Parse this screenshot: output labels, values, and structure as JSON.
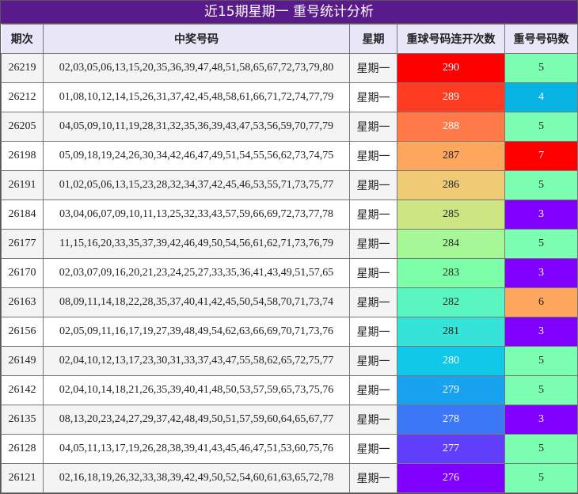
{
  "title": "近15期星期一 重号统计分析",
  "headers": [
    "期次",
    "中奖号码",
    "星期",
    "重球号码连开次数",
    "重号号码数"
  ],
  "rows": [
    {
      "period": "26219",
      "numbers": "02,03,05,06,13,15,20,35,36,39,47,48,51,58,65,67,72,73,79,80",
      "weekday": "星期一",
      "consecutive": "290",
      "repeat": "5",
      "consec_bg": "#ff0000",
      "repeat_bg": "#7dffb3"
    },
    {
      "period": "26212",
      "numbers": "01,08,10,12,14,15,26,31,37,42,45,48,58,61,66,71,72,74,77,79",
      "weekday": "星期一",
      "consecutive": "289",
      "repeat": "4",
      "consec_bg": "#ff3b22",
      "repeat_bg": "#06b3e3"
    },
    {
      "period": "26205",
      "numbers": "04,05,09,10,11,19,28,31,32,35,36,39,43,47,53,56,59,70,77,79",
      "weekday": "星期一",
      "consecutive": "288",
      "repeat": "5",
      "consec_bg": "#ff7a48",
      "repeat_bg": "#7dffb3"
    },
    {
      "period": "26198",
      "numbers": "05,09,18,19,24,26,30,34,42,46,47,49,51,54,55,56,62,73,74,75",
      "weekday": "星期一",
      "consecutive": "287",
      "repeat": "7",
      "consec_bg": "#fda65e",
      "repeat_bg": "#ff0000"
    },
    {
      "period": "26191",
      "numbers": "01,02,05,06,13,15,23,28,32,34,37,42,45,46,53,55,71,73,75,77",
      "weekday": "星期一",
      "consecutive": "286",
      "repeat": "5",
      "consec_bg": "#eecb74",
      "repeat_bg": "#7dffb3"
    },
    {
      "period": "26184",
      "numbers": "03,04,06,07,09,10,11,13,25,32,33,43,57,59,66,69,72,73,77,78",
      "weekday": "星期一",
      "consecutive": "285",
      "repeat": "3",
      "consec_bg": "#cce684",
      "repeat_bg": "#7f00ff"
    },
    {
      "period": "26177",
      "numbers": "11,15,16,20,33,35,37,39,42,46,49,50,54,56,61,62,71,73,76,79",
      "weekday": "星期一",
      "consecutive": "284",
      "repeat": "5",
      "consec_bg": "#a6f896",
      "repeat_bg": "#7dffb3"
    },
    {
      "period": "26170",
      "numbers": "02,03,07,09,16,20,21,23,24,25,27,33,35,36,41,43,49,51,57,65",
      "weekday": "星期一",
      "consecutive": "283",
      "repeat": "3",
      "consec_bg": "#7dffaa",
      "repeat_bg": "#7f00ff"
    },
    {
      "period": "26163",
      "numbers": "08,09,11,14,18,22,28,35,37,40,41,42,45,50,54,58,70,71,73,74",
      "weekday": "星期一",
      "consecutive": "282",
      "repeat": "6",
      "consec_bg": "#59f6c2",
      "repeat_bg": "#fda65e"
    },
    {
      "period": "26156",
      "numbers": "02,05,09,11,16,17,19,27,39,48,49,54,62,63,66,69,70,71,73,76",
      "weekday": "星期一",
      "consecutive": "281",
      "repeat": "3",
      "consec_bg": "#35e3d8",
      "repeat_bg": "#7f00ff"
    },
    {
      "period": "26149",
      "numbers": "02,04,10,12,13,17,23,30,31,33,37,43,47,55,58,62,65,72,75,77",
      "weekday": "星期一",
      "consecutive": "280",
      "repeat": "5",
      "consec_bg": "#10c8e8",
      "repeat_bg": "#7dffb3"
    },
    {
      "period": "26142",
      "numbers": "02,04,10,14,18,21,26,35,39,40,41,48,50,53,57,59,65,73,75,76",
      "weekday": "星期一",
      "consecutive": "279",
      "repeat": "5",
      "consec_bg": "#18a2f0",
      "repeat_bg": "#7dffb3"
    },
    {
      "period": "26135",
      "numbers": "08,13,20,23,24,27,29,37,42,48,49,50,51,57,59,60,64,65,67,77",
      "weekday": "星期一",
      "consecutive": "278",
      "repeat": "3",
      "consec_bg": "#3c77f5",
      "repeat_bg": "#7f00ff"
    },
    {
      "period": "26128",
      "numbers": "04,05,11,13,17,19,26,28,38,39,41,43,45,46,47,51,53,60,75,76",
      "weekday": "星期一",
      "consecutive": "277",
      "repeat": "5",
      "consec_bg": "#613efc",
      "repeat_bg": "#7dffb3"
    },
    {
      "period": "26121",
      "numbers": "02,16,18,19,26,32,33,38,39,42,49,50,52,54,60,61,63,65,72,78",
      "weekday": "星期一",
      "consecutive": "276",
      "repeat": "5",
      "consec_bg": "#8000ff",
      "repeat_bg": "#7dffb3"
    }
  ]
}
